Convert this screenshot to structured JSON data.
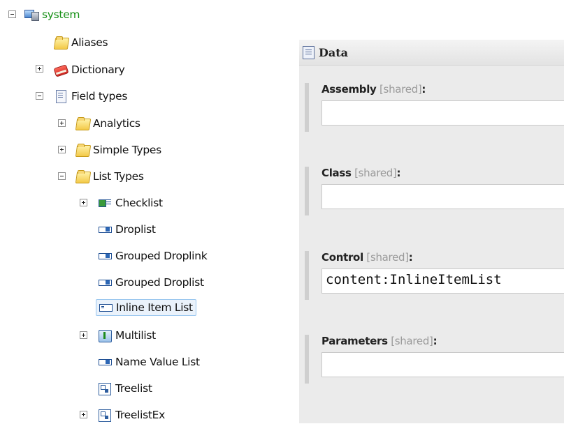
{
  "tree": {
    "root": {
      "label": "system"
    },
    "items": {
      "aliases": "Aliases",
      "dictionary": "Dictionary",
      "field_types": "Field types",
      "analytics": "Analytics",
      "simple_types": "Simple Types",
      "list_types": "List Types",
      "checklist": "Checklist",
      "droplist": "Droplist",
      "grouped_droplink": "Grouped Droplink",
      "grouped_droplist": "Grouped Droplist",
      "inline_item_list": "Inline Item List",
      "multilist": "Multilist",
      "name_value_list": "Name Value List",
      "treelist": "Treelist",
      "treelistex": "TreelistEx"
    },
    "selected": "Inline Item List"
  },
  "panel": {
    "title": "Data",
    "fields": [
      {
        "label": "Assembly",
        "shared": "[shared]",
        "colon": ":",
        "value": ""
      },
      {
        "label": "Class",
        "shared": "[shared]",
        "colon": ":",
        "value": ""
      },
      {
        "label": "Control",
        "shared": "[shared]",
        "colon": ":",
        "value": "content:InlineItemList"
      },
      {
        "label": "Parameters",
        "shared": "[shared]",
        "colon": ":",
        "value": ""
      }
    ]
  },
  "colors": {
    "root_text": "#169016",
    "panel_bg": "#ebebeb",
    "selection_border": "#99c6ef",
    "selection_bg": "#eaf2fb"
  }
}
